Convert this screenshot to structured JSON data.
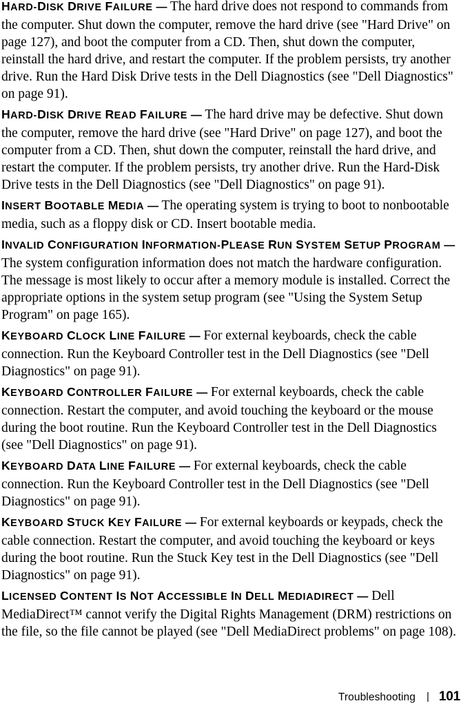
{
  "page": {
    "document_type": "printed-manual-page",
    "entries": [
      {
        "term": "Hard-disk drive failure",
        "dash": "—",
        "body": "The hard drive does not respond to commands from the computer. Shut down the computer, remove the hard drive (see \"Hard Drive\" on page 127), and boot the computer from a CD. Then, shut down the computer, reinstall the hard drive, and restart the computer. If the problem persists, try another drive. Run the Hard Disk Drive tests in the Dell Diagnostics (see \"Dell Diagnostics\" on page 91)."
      },
      {
        "term": "Hard-disk drive read failure",
        "dash": "—",
        "body": "The hard drive may be defective. Shut down the computer, remove the hard drive (see \"Hard Drive\" on page 127), and boot the computer from a CD. Then, shut down the computer, reinstall the hard drive, and restart the computer. If the problem persists, try another drive. Run the Hard-Disk Drive tests in the Dell Diagnostics (see \"Dell Diagnostics\" on page 91)."
      },
      {
        "term": "Insert bootable media",
        "dash": "—",
        "body": "The operating system is trying to boot to nonbootable media, such as a floppy disk or CD. Insert bootable media."
      },
      {
        "term": "Invalid configuration information-please run System Setup Program",
        "dash": "—",
        "body": "The system configuration information does not match the hardware configuration. The message is most likely to occur after a memory module is installed. Correct the appropriate options in the system setup program (see \"Using the System Setup Program\" on page 165)."
      },
      {
        "term": "Keyboard clock line failure",
        "dash": "—",
        "body": "For external keyboards, check the cable connection. Run the Keyboard Controller test in the Dell Diagnostics (see \"Dell Diagnostics\" on page 91)."
      },
      {
        "term": "Keyboard controller failure",
        "dash": "—",
        "body": "For external keyboards, check the cable connection. Restart the computer, and avoid touching the keyboard or the mouse during the boot routine. Run the Keyboard Controller test in the Dell Diagnostics (see \"Dell Diagnostics\" on page 91)."
      },
      {
        "term": "Keyboard data line failure",
        "dash": "—",
        "body": "For external keyboards, check the cable connection. Run the Keyboard Controller test in the Dell Diagnostics (see \"Dell Diagnostics\" on page 91)."
      },
      {
        "term": "Keyboard stuck key failure",
        "dash": "—",
        "body": "For external keyboards or keypads, check the cable connection. Restart the computer, and avoid touching the keyboard or keys during the boot routine. Run the Stuck Key test in the Dell Diagnostics (see \"Dell Diagnostics\" on page 91)."
      },
      {
        "term": "Licensed content is not accessible in Dell MediaDirect",
        "dash": "—",
        "body": "Dell MediaDirect™ cannot verify the Digital Rights Management (DRM) restrictions on the file, so the file cannot be played (see \"Dell MediaDirect problems\" on page 108)."
      }
    ]
  },
  "footer": {
    "section": "Troubleshooting",
    "separator": "|",
    "page_number": "101"
  },
  "colors": {
    "text": "#000000",
    "background": "#ffffff"
  }
}
